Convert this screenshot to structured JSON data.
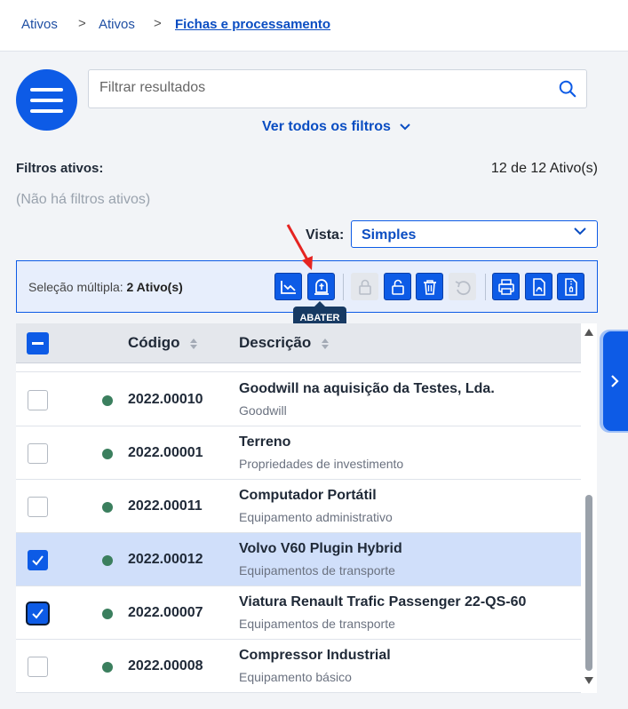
{
  "breadcrumb": {
    "items": [
      "Ativos",
      "Ativos",
      "Fichas e processamento"
    ]
  },
  "search": {
    "placeholder": "Filtrar resultados",
    "value": ""
  },
  "filters": {
    "see_all_label": "Ver todos os filtros",
    "active_label": "Filtros ativos:",
    "none_label": "(Não há filtros ativos)",
    "count_label": "12 de 12 Ativo(s)"
  },
  "view": {
    "label": "Vista:",
    "selected": "Simples"
  },
  "toolbar": {
    "selection_prefix": "Seleção múltipla:",
    "selection_count": "2 Ativo(s)",
    "tooltip": "ABATER",
    "buttons": [
      "chart-down-icon",
      "tombstone-icon",
      "lock-icon",
      "unlock-icon",
      "trash-icon",
      "undo-icon",
      "print-icon",
      "pdf-icon",
      "zip-icon"
    ]
  },
  "table": {
    "columns": [
      "Código",
      "Descrição"
    ],
    "rows": [
      {
        "code": "2022.00010",
        "description": "Goodwill na aquisição da Testes, Lda.",
        "category": "Goodwill",
        "checked": false
      },
      {
        "code": "2022.00001",
        "description": "Terreno",
        "category": "Propriedades de investimento",
        "checked": false
      },
      {
        "code": "2022.00011",
        "description": "Computador Portátil",
        "category": "Equipamento administrativo",
        "checked": false
      },
      {
        "code": "2022.00012",
        "description": "Volvo V60 Plugin Hybrid",
        "category": "Equipamentos de transporte",
        "checked": true
      },
      {
        "code": "2022.00007",
        "description": "Viatura Renault Trafic Passenger 22-QS-60",
        "category": "Equipamentos de transporte",
        "checked": true
      },
      {
        "code": "2022.00008",
        "description": "Compressor Industrial",
        "category": "Equipamento básico",
        "checked": false
      }
    ]
  },
  "colors": {
    "primary": "#0d5be6",
    "status_active": "#3b7f5e",
    "selected_row": "#d0dffa"
  }
}
